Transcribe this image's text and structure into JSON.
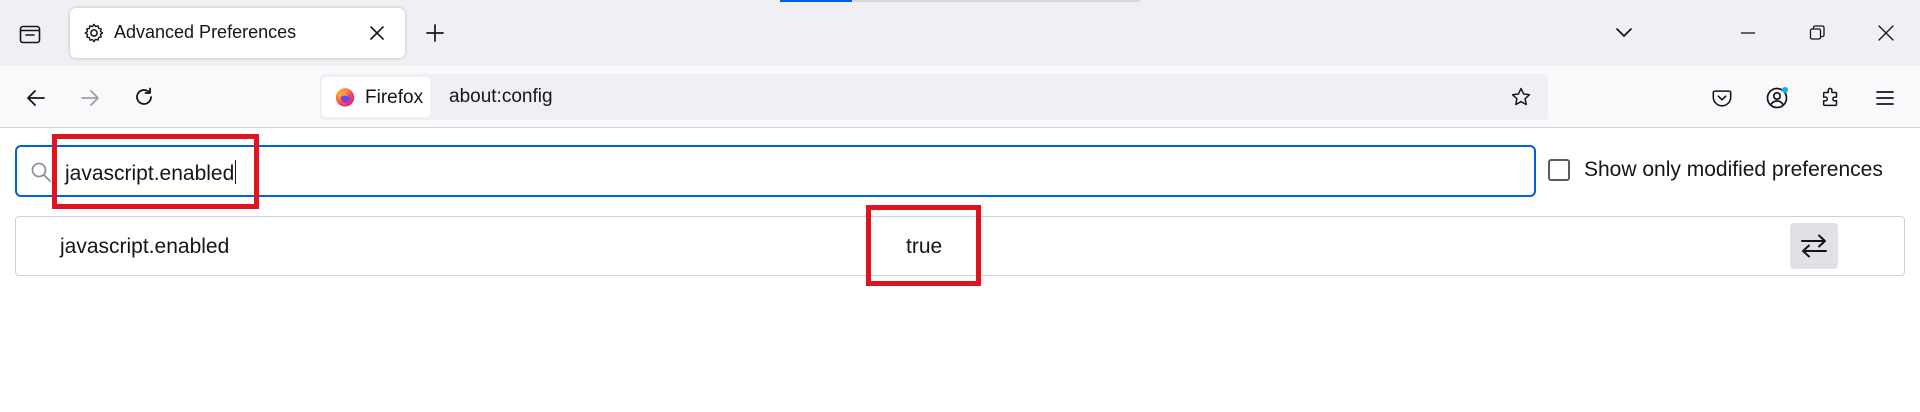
{
  "browser": {
    "tab": {
      "title": "Advanced Preferences",
      "icon": "gear-icon"
    },
    "toolbar": {
      "identity_label": "Firefox",
      "url": "about:config"
    }
  },
  "config": {
    "search": {
      "value": "javascript.enabled"
    },
    "filter": {
      "label": "Show only modified preferences",
      "checked": false
    },
    "preferences": [
      {
        "name": "javascript.enabled",
        "value": "true",
        "action_icon": "toggle-icon"
      }
    ]
  },
  "colors": {
    "accent": "#0061e0",
    "highlight": "#e0131f",
    "chrome": "#f0f0f4"
  }
}
